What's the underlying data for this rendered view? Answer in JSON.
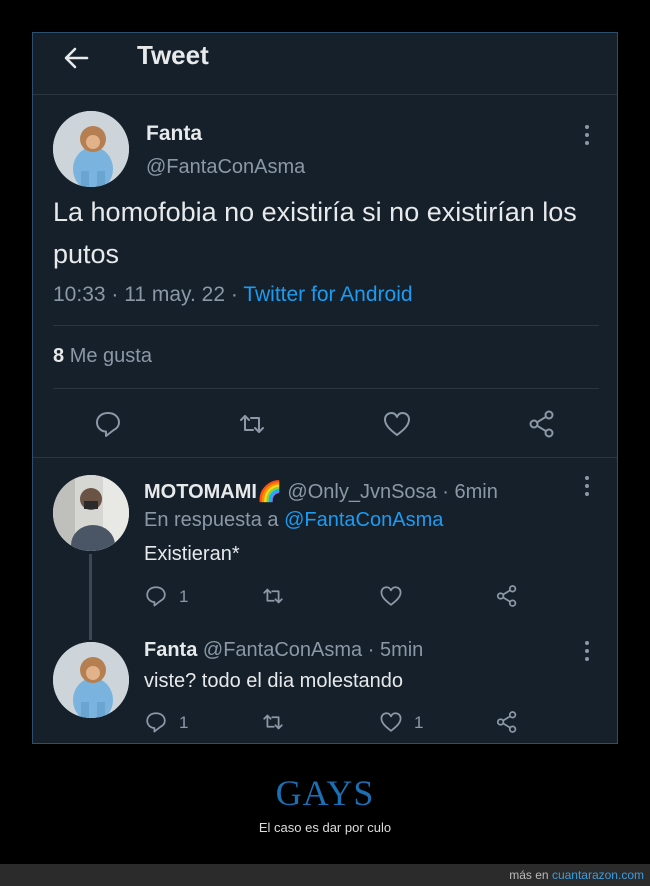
{
  "header": {
    "title": "Tweet"
  },
  "tweet": {
    "author_name": "Fanta",
    "author_handle": "@FantaConAsma",
    "text": "La homofobia no existiría si no existirían los putos",
    "time": "10:33",
    "date": "11 may. 22",
    "source": "Twitter for Android",
    "likes_count": "8",
    "likes_label": "Me gusta"
  },
  "replies": [
    {
      "author_name": "MOTOMAMI",
      "author_emoji": "🌈",
      "author_handle": "@Only_JvnSosa",
      "time_ago": "6min",
      "reply_to_label": "En respuesta a",
      "reply_to_handle": "@FantaConAsma",
      "text": "Existieran*",
      "reply_count": "1",
      "retweet_count": "",
      "like_count": ""
    },
    {
      "author_name": "Fanta",
      "author_handle": "@FantaConAsma",
      "time_ago": "5min",
      "text": "viste? todo el dia molestando",
      "reply_count": "1",
      "retweet_count": "",
      "like_count": "1"
    }
  ],
  "footer": {
    "title": "GAYS",
    "subtitle": "El caso es dar por culo",
    "more_label": "más en",
    "site": "cuantarazon.com"
  },
  "colors": {
    "background": "#15202b",
    "accent": "#1d9bf0",
    "muted": "#8b98a5",
    "title_blue": "#1a6fb5"
  }
}
